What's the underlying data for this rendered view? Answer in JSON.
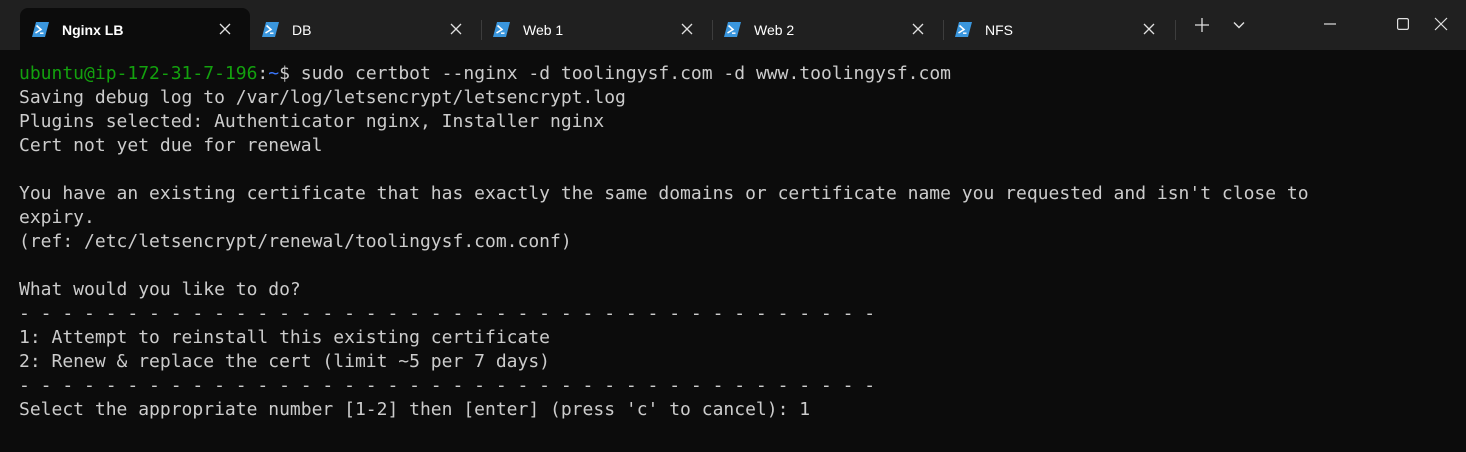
{
  "tabs": [
    {
      "label": "Nginx LB",
      "active": true
    },
    {
      "label": "DB",
      "active": false
    },
    {
      "label": "Web 1",
      "active": false
    },
    {
      "label": "Web 2",
      "active": false
    },
    {
      "label": "NFS",
      "active": false
    }
  ],
  "tab_icon": "powershell-icon",
  "new_tab_icon": "plus-icon",
  "dropdown_icon": "chevron-down-icon",
  "window_controls": [
    "minimize-icon",
    "maximize-icon",
    "close-icon"
  ],
  "colors": {
    "prompt_user": "#13a10e",
    "prompt_path": "#3b78ff",
    "text": "#cccccc",
    "background": "#0c0c0c",
    "tabbar": "#202020",
    "tab_icon": "#3a96dd"
  },
  "terminal": {
    "prompt": {
      "user_host": "ubuntu@ip-172-31-7-196",
      "colon": ":",
      "path": "~",
      "symbol": "$ ",
      "command": "sudo certbot --nginx -d toolingysf.com -d www.toolingysf.com"
    },
    "lines": [
      "Saving debug log to /var/log/letsencrypt/letsencrypt.log",
      "Plugins selected: Authenticator nginx, Installer nginx",
      "Cert not yet due for renewal",
      "",
      "You have an existing certificate that has exactly the same domains or certificate name you requested and isn't close to",
      "expiry.",
      "(ref: /etc/letsencrypt/renewal/toolingysf.com.conf)",
      "",
      "What would you like to do?",
      "- - - - - - - - - - - - - - - - - - - - - - - - - - - - - - - - - - - - - - - -",
      "1: Attempt to reinstall this existing certificate",
      "2: Renew & replace the cert (limit ~5 per 7 days)",
      "- - - - - - - - - - - - - - - - - - - - - - - - - - - - - - - - - - - - - - - -",
      "Select the appropriate number [1-2] then [enter] (press 'c' to cancel): 1"
    ]
  }
}
